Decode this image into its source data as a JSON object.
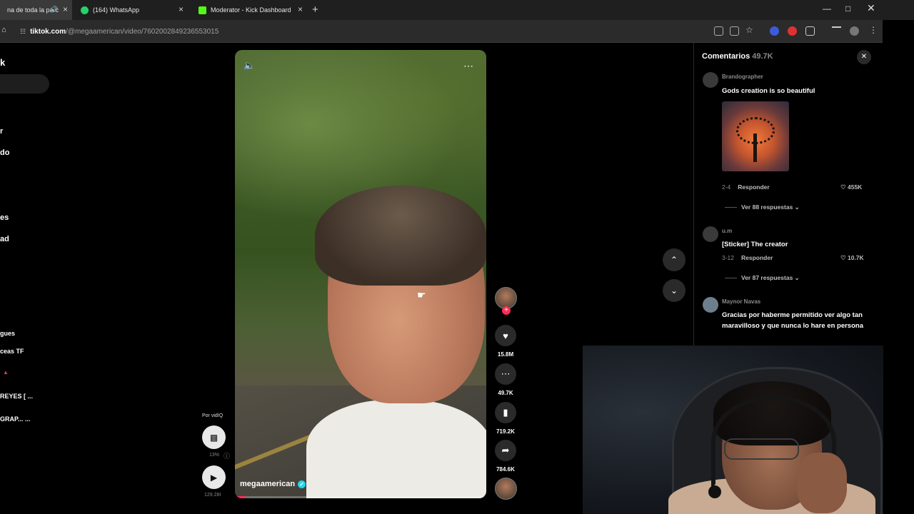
{
  "browser": {
    "tabs": [
      {
        "title": "na de toda la parc",
        "active": true,
        "favicon_color": "#777777"
      },
      {
        "title": "(164) WhatsApp",
        "active": false,
        "favicon_color": "#25D366"
      },
      {
        "title": "Moderator - Kick Dashboard",
        "active": false,
        "favicon_color": "#53FC18"
      }
    ],
    "url_host": "tiktok.com",
    "url_path": "/@megaamerican/video/7602002849236553015"
  },
  "sidebar": {
    "labels": [
      "k",
      "r",
      "do",
      "es",
      "ad",
      "gues",
      "ceas TF",
      "REYES [ ...",
      "GRAP... ..."
    ]
  },
  "video": {
    "username": "megaamerican",
    "progress": 0.04
  },
  "actions": {
    "likes": "15.8M",
    "comments": "49.7K",
    "saves": "719.2K",
    "shares": "784.6K"
  },
  "vidiq": {
    "label": "Por vidIQ",
    "percent": "13%",
    "count": "129.28I"
  },
  "comments_panel": {
    "title": "Comentarios",
    "count": "49.7K",
    "items": [
      {
        "user": "Brandographer",
        "text": "Gods creation is so beautiful",
        "date": "2-4",
        "reply": "Responder",
        "likes": "455K",
        "more": "Ver 88 respuestas"
      },
      {
        "user": "u.m",
        "text": "[Sticker] The creator",
        "date": "3-12",
        "reply": "Responder",
        "likes": "10.7K",
        "more": "Ver 87 respuestas"
      },
      {
        "user": "Maynor Navas",
        "text": "Gracias por haberme permitido ver algo tan maravilloso y que nunca lo hare en persona"
      }
    ]
  },
  "colors": {
    "accent": "#fe2c55",
    "verified": "#20d5ec",
    "background": "#000000"
  }
}
